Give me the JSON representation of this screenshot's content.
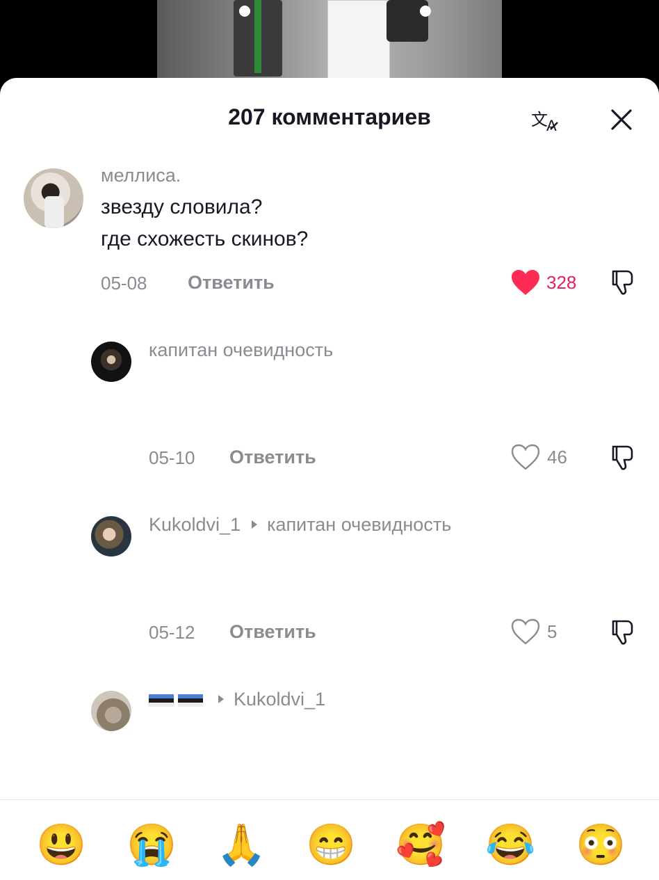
{
  "header": {
    "title": "207 комментариев"
  },
  "comments": [
    {
      "username": "меллиса.",
      "text_lines": [
        "звезду словила?",
        "где схожесть скинов?"
      ],
      "date": "05-08",
      "reply_label": "Ответить",
      "likes": "328",
      "liked": true
    },
    {
      "username": "капитан очевидность",
      "date": "05-10",
      "reply_label": "Ответить",
      "likes": "46",
      "liked": false
    },
    {
      "username": "Kukoldvi_1",
      "reply_to": "капитан очевидность",
      "date": "05-12",
      "reply_label": "Ответить",
      "likes": "5",
      "liked": false
    },
    {
      "username": "",
      "reply_to": "Kukoldvi_1"
    }
  ],
  "emoji_bar": [
    "😃",
    "😭",
    "🙏",
    "😁",
    "🥰",
    "😂",
    "😳"
  ],
  "colors": {
    "liked_heart": "#fe2c55",
    "muted_text": "#8a8b91",
    "primary_text": "#161823"
  }
}
